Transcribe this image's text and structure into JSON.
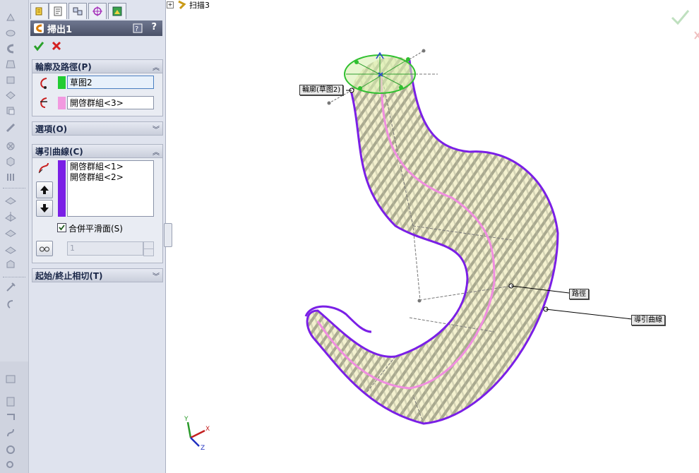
{
  "feature_tree": {
    "item_label": "扫描3"
  },
  "property_manager": {
    "title": "掃出1",
    "help_label": "?",
    "sections": {
      "profile_path": {
        "header": "輪廓及路徑(P)",
        "profile_value": "草图2",
        "path_value": "開啓群組<3>",
        "profile_color": "#22cc33",
        "path_color": "#f29ae0"
      },
      "options": {
        "header": "選項(O)"
      },
      "guide_curves": {
        "header": "導引曲線(C)",
        "items": [
          "開啓群組<1>",
          "開啓群組<2>"
        ],
        "color": "#7a1fe6",
        "merge_label": "合併平滑面(S)",
        "merge_checked": true,
        "spin_value": "1"
      },
      "tangency": {
        "header": "起始/終止相切(T)"
      }
    }
  },
  "callouts": {
    "profile": "輪廓(草图2)",
    "path": "路徑",
    "guide": "導引曲線"
  },
  "axes": {
    "x": "X",
    "y": "Y",
    "z": "Z"
  },
  "colors": {
    "guide_curve": "#7a1fe6",
    "path_curve": "#f08ee0",
    "surface_fill": "#f4f1cf",
    "surface_stripe": "#a9a98f",
    "profile_sketch": "#30c030"
  }
}
